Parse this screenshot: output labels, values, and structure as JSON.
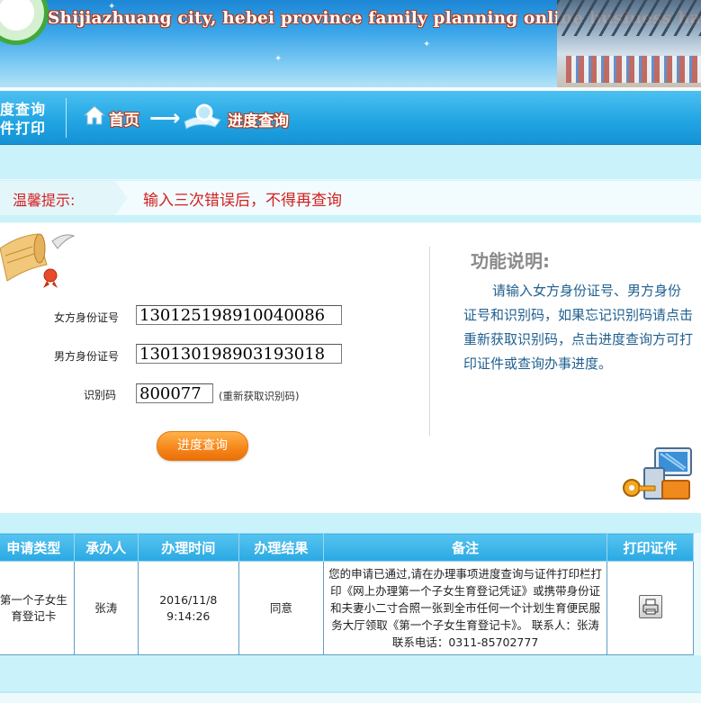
{
  "header": {
    "subtitle": "Shijiazhuang city, hebei province family planning online business hall"
  },
  "nav": {
    "side_label_line1": "度查询",
    "side_label_line2": "件打印",
    "home_label": "首页",
    "current_label": "进度查询"
  },
  "tip": {
    "label": "温馨提示:",
    "message": "输入三次错误后，不得再查询"
  },
  "form": {
    "female_id_label": "女方身份证号",
    "female_id_value": "130125198910040086",
    "male_id_label": "男方身份证号",
    "male_id_value": "130130198903193018",
    "code_label": "识别码",
    "code_value": "800077",
    "refresh_link": "(重新获取识别码)",
    "query_button": "进度查询"
  },
  "help": {
    "title": "功能说明:",
    "text": "请输入女方身份证号、男方身份证号和识别码，如果忘记识别码请点击重新获取识别码，点击进度查询方可打印证件或查询办事进度。"
  },
  "results": {
    "headers": [
      "申请类型",
      "承办人",
      "办理时间",
      "办理结果",
      "备注",
      "打印证件"
    ],
    "rows": [
      {
        "type": "第一个子女生育登记卡",
        "handler": "张涛",
        "date": "2016/11/8",
        "time": "9:14:26",
        "result": "同意",
        "remark": "您的申请已通过,请在办理事项进度查询与证件打印栏打印《网上办理第一个子女生育登记凭证》或携带身份证和夫妻小二寸合照一张到全市任何一个计划生育便民服务大厅领取《第一个子女生育登记卡》。 联系人：张涛 联系电话：0311-85702777",
        "print_icon": "printer-icon"
      }
    ]
  },
  "colors": {
    "nav_blue": "#23a6e4",
    "tip_red": "#d42020",
    "button_orange": "#f7891c",
    "help_text_blue": "#1f5f8f"
  }
}
